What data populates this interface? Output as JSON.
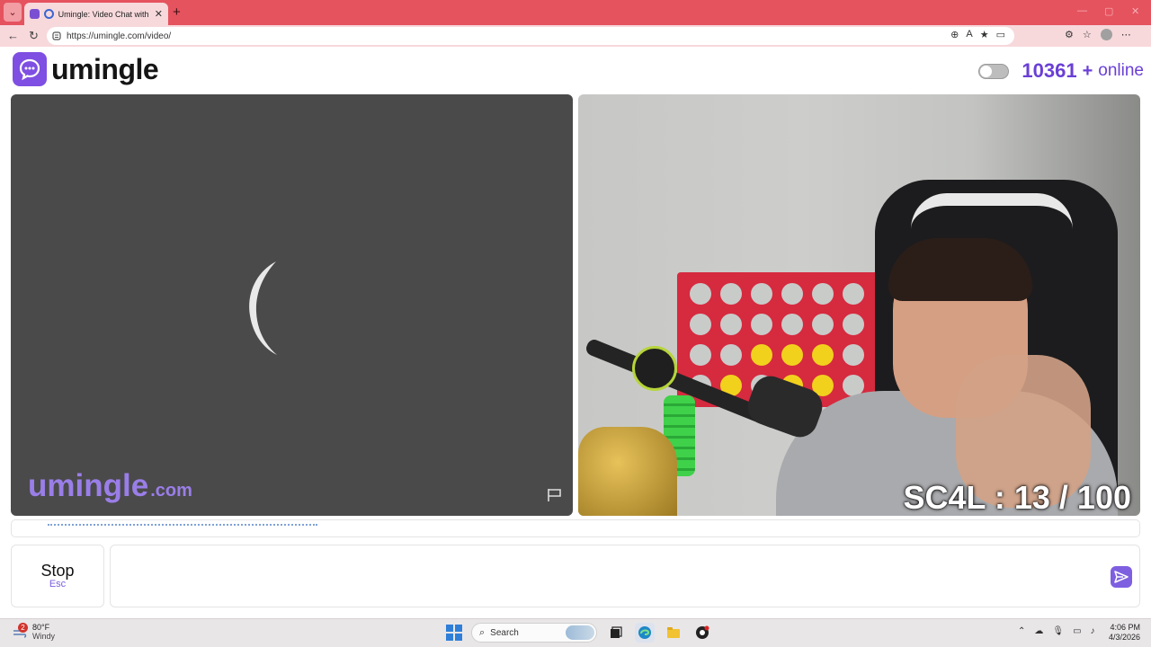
{
  "browser": {
    "tab_title": "Umingle: Video Chat with Stra",
    "url": "https://umingle.com/video/",
    "new_tab_symbol": "+",
    "close_symbol": "✕"
  },
  "header": {
    "logo_text": "umingle",
    "online_count": "10361",
    "online_plus": "+",
    "online_label": "online"
  },
  "video_left": {
    "watermark_main": "umingle",
    "watermark_domain": ".com"
  },
  "video_right": {
    "overlay_text": "SC4L : 13 / 100"
  },
  "controls": {
    "stop_label": "Stop",
    "stop_key": "Esc",
    "chat_placeholder": ""
  },
  "taskbar": {
    "weather_badge": "2",
    "weather_temp": "80°F",
    "weather_desc": "Windy",
    "search_label": "Search",
    "time": "4:06 PM",
    "date": "4/3/2026"
  },
  "colors": {
    "brand_purple": "#7e4fe2",
    "browser_accent": "#e5535f",
    "online_text": "#6a3fd6"
  }
}
